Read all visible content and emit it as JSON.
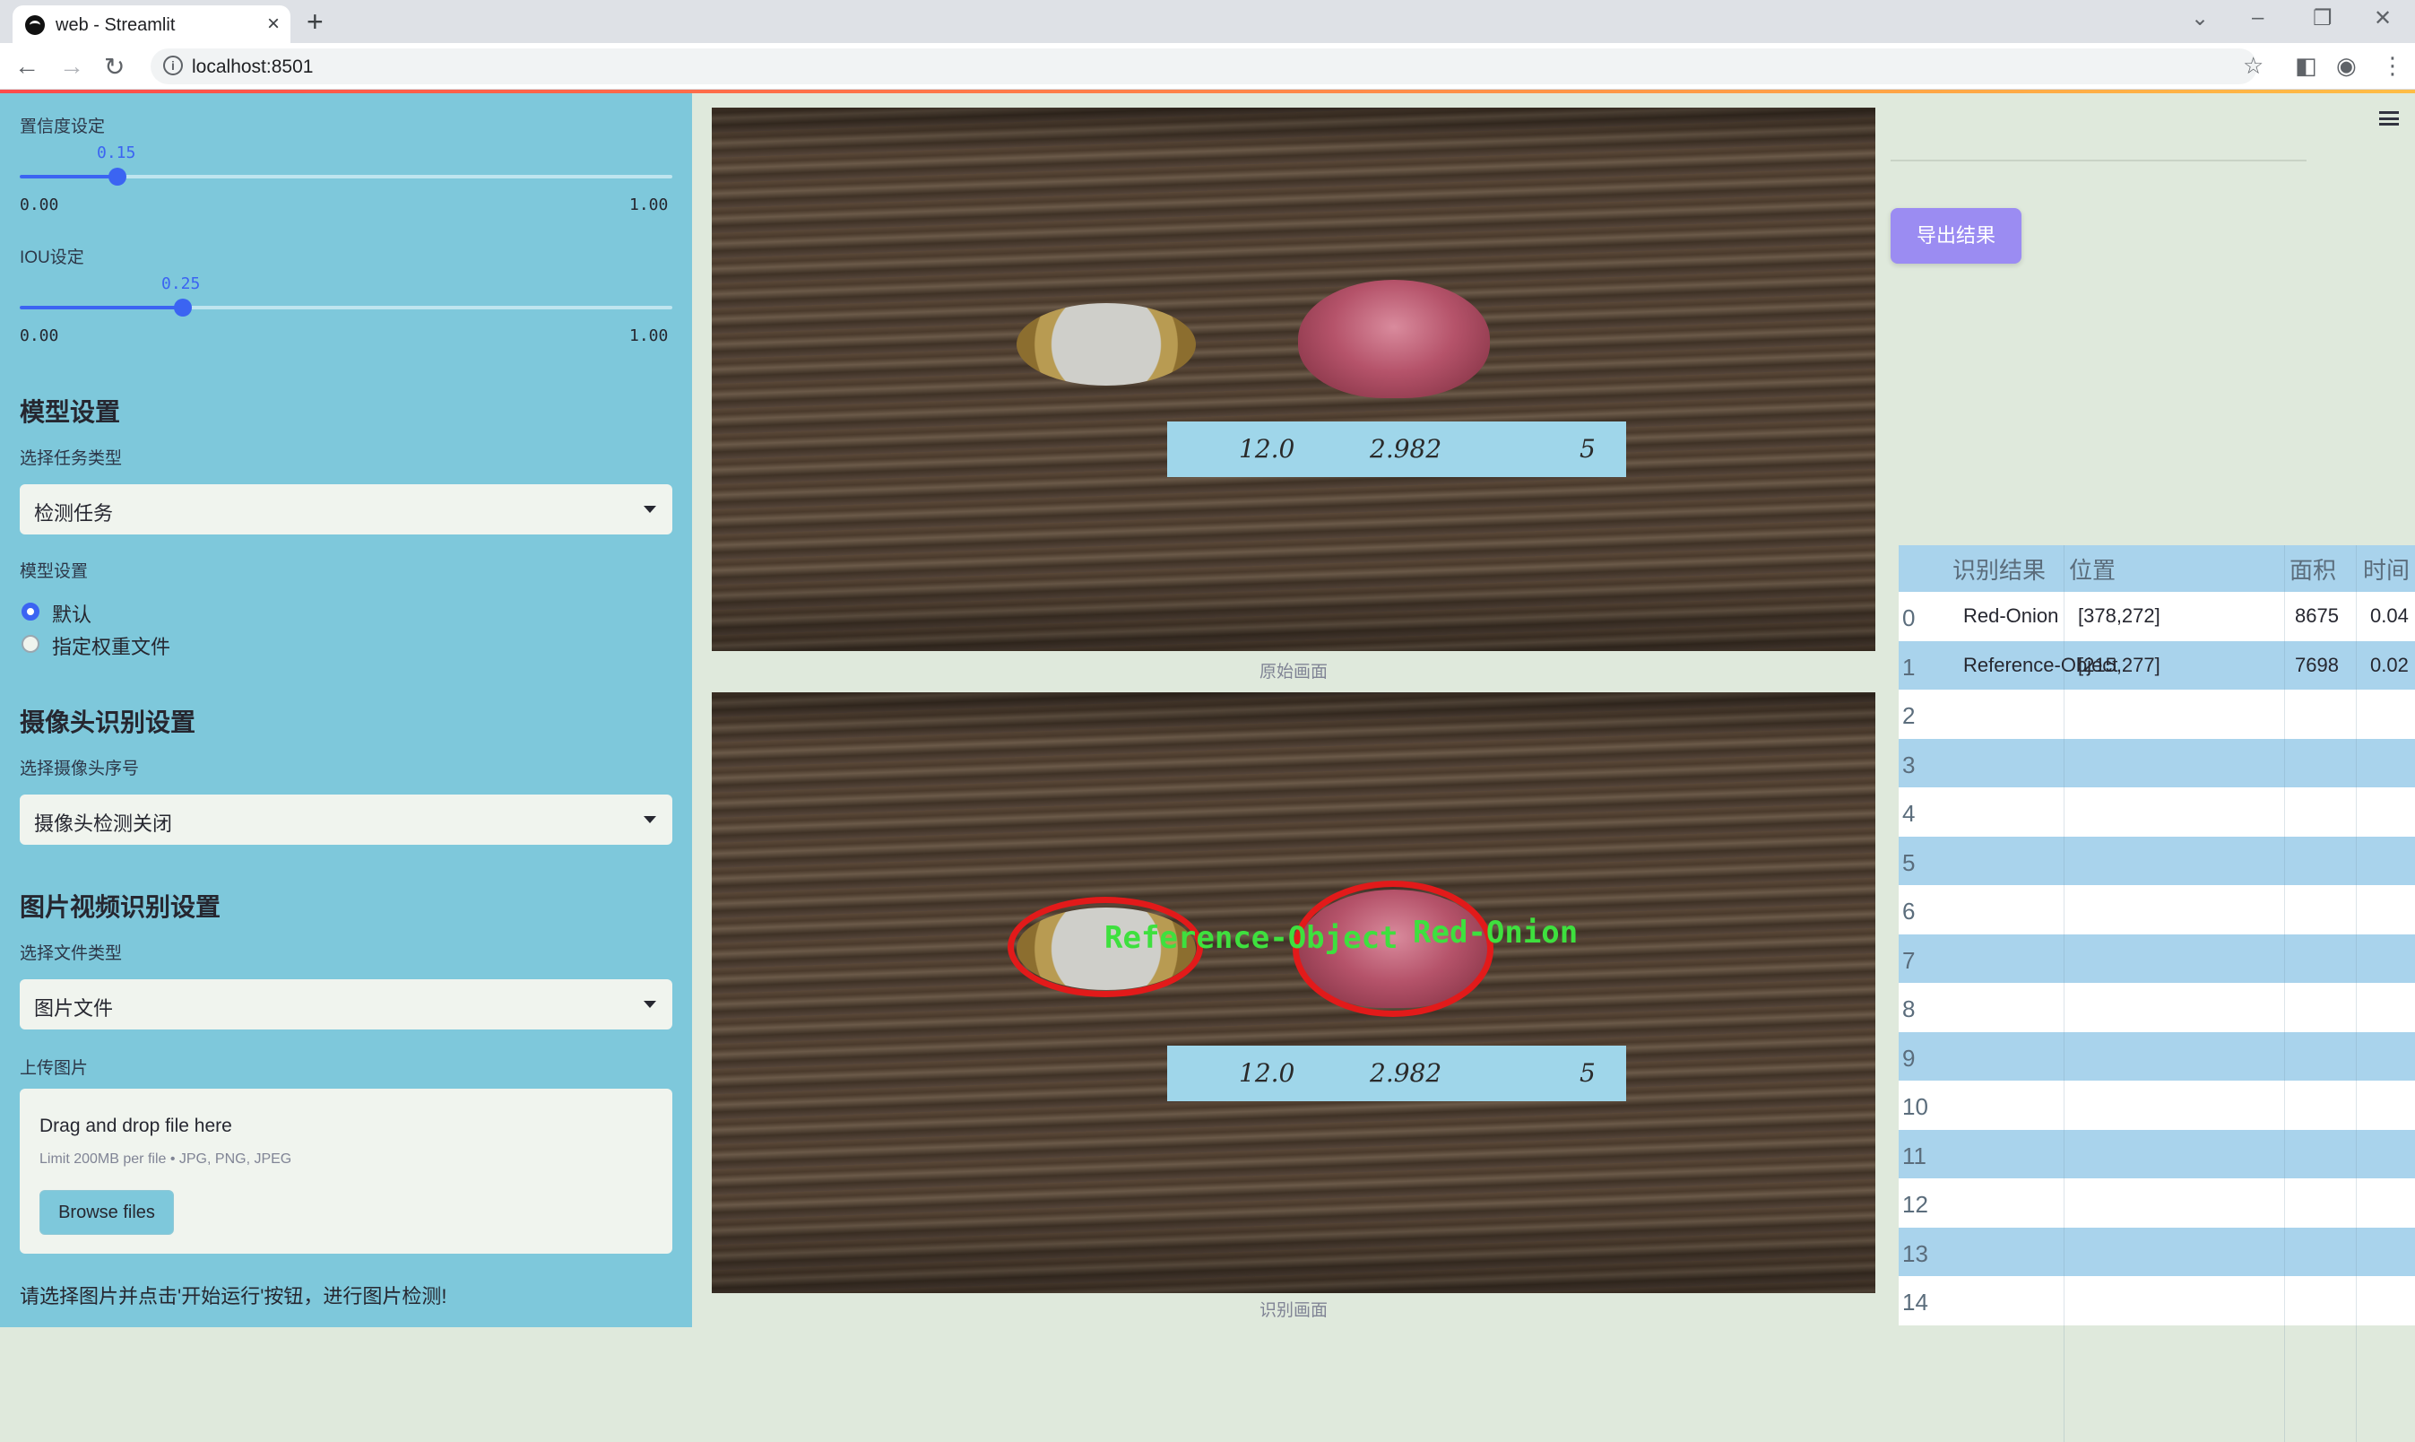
{
  "browser": {
    "tab_title": "web - Streamlit",
    "url": "localhost:8501"
  },
  "sidebar": {
    "confidence": {
      "label": "置信度设定",
      "value": "0.15",
      "fraction": 0.15,
      "min": "0.00",
      "max": "1.00"
    },
    "iou": {
      "label": "IOU设定",
      "value": "0.25",
      "fraction": 0.25,
      "min": "0.00",
      "max": "1.00"
    },
    "model_section": {
      "heading": "模型设置",
      "task_label": "选择任务类型",
      "task_value": "检测任务",
      "model_label": "模型设置",
      "options": [
        "默认",
        "指定权重文件"
      ],
      "selected": 0
    },
    "camera_section": {
      "heading": "摄像头识别设置",
      "camera_label": "选择摄像头序号",
      "camera_value": "摄像头检测关闭"
    },
    "media_section": {
      "heading": "图片视频识别设置",
      "file_type_label": "选择文件类型",
      "file_type_value": "图片文件",
      "upload_label": "上传图片",
      "drop_title": "Drag and drop file here",
      "drop_limit": "Limit 200MB per file • JPG, PNG, JPEG",
      "browse_label": "Browse files"
    },
    "footer_note": "请选择图片并点击'开始运行'按钮，进行图片检测!"
  },
  "main": {
    "original_caption": "原始画面",
    "detected_caption": "识别画面",
    "note_values": [
      "12.0",
      "2.982",
      "5"
    ],
    "detection_labels": [
      "Reference-Object",
      "Red-Onion"
    ],
    "export_button": "导出结果",
    "colors": {
      "accent": "#3b64f2",
      "export": "#9b8cf2",
      "sidebar": "#7ec8db",
      "box": "#e21a1a",
      "label": "#3ee03e"
    }
  },
  "table": {
    "headers": [
      "识别结果",
      "位置",
      "面积",
      "时间"
    ],
    "rows": [
      {
        "index": "0",
        "result": "Red-Onion",
        "position": "[378,272]",
        "area": "8675",
        "time": "0.04"
      },
      {
        "index": "1",
        "result": "Reference-Object",
        "position": "[215,277]",
        "area": "7698",
        "time": "0.02"
      },
      {
        "index": "2"
      },
      {
        "index": "3"
      },
      {
        "index": "4"
      },
      {
        "index": "5"
      },
      {
        "index": "6"
      },
      {
        "index": "7"
      },
      {
        "index": "8"
      },
      {
        "index": "9"
      },
      {
        "index": "10"
      },
      {
        "index": "11"
      },
      {
        "index": "12"
      },
      {
        "index": "13"
      },
      {
        "index": "14"
      }
    ]
  }
}
